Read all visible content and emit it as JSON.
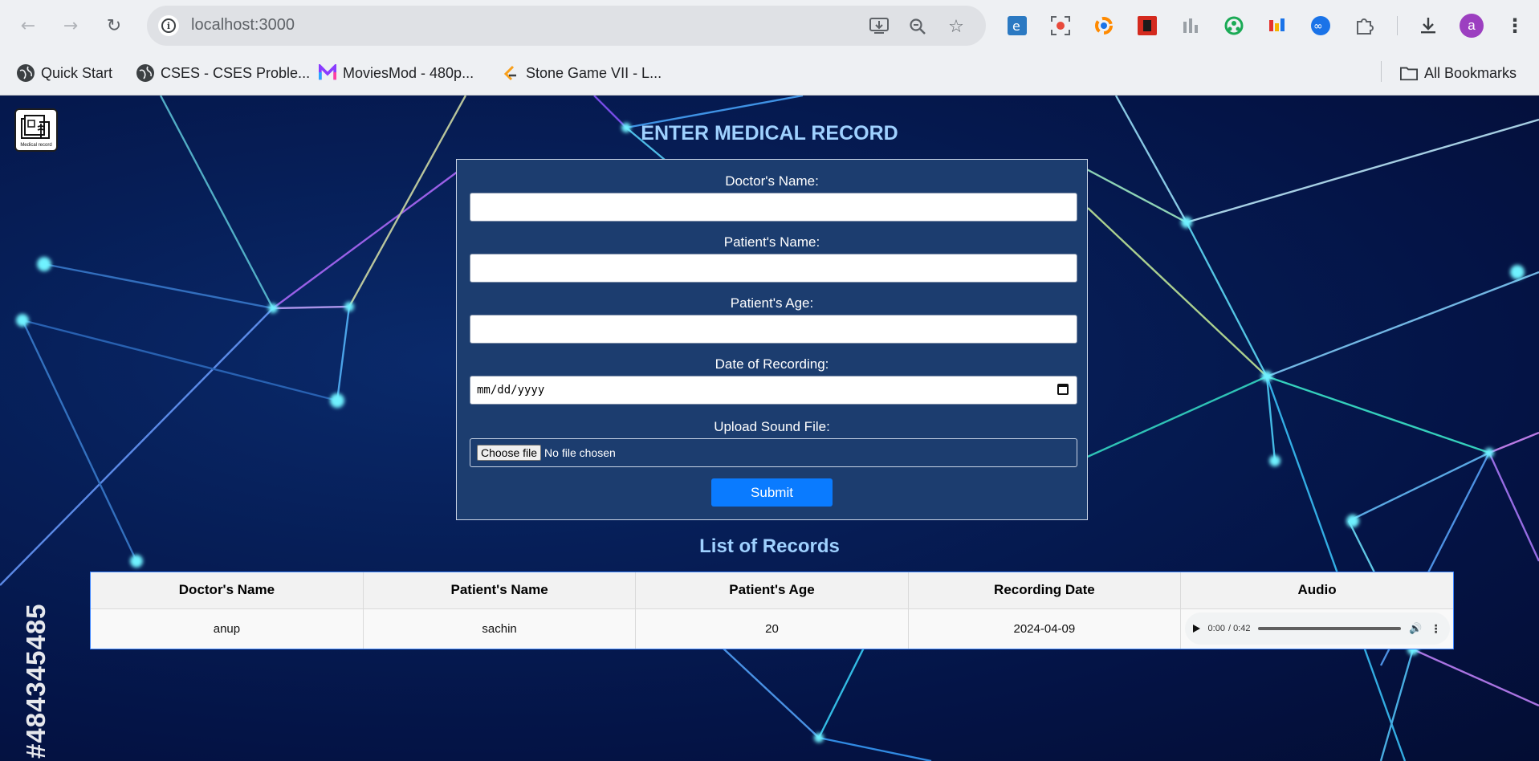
{
  "browser": {
    "url": "localhost:3000",
    "bookmarks": [
      {
        "label": "Quick Start"
      },
      {
        "label": "CSES - CSES Proble..."
      },
      {
        "label": "MoviesMod - 480p..."
      },
      {
        "label": "Stone Game VII - L..."
      }
    ],
    "all_bookmarks_label": "All Bookmarks",
    "avatar_letter": "a"
  },
  "logo": {
    "caption": "Medical record"
  },
  "watermark_id": "#484345485",
  "form": {
    "title": "ENTER MEDICAL RECORD",
    "doctor_label": "Doctor's Name:",
    "patient_label": "Patient's Name:",
    "age_label": "Patient's Age:",
    "date_label": "Date of Recording:",
    "date_placeholder": "mm/dd/yyyy",
    "file_label": "Upload Sound File:",
    "file_button": "Choose file",
    "file_status": "No file chosen",
    "submit_label": "Submit"
  },
  "records": {
    "title": "List of Records",
    "columns": [
      "Doctor's Name",
      "Patient's Name",
      "Patient's Age",
      "Recording Date",
      "Audio"
    ],
    "rows": [
      {
        "doctor": "anup",
        "patient": "sachin",
        "age": "20",
        "date": "2024-04-09",
        "audio_time": "0:00",
        "audio_duration": "/ 0:42"
      }
    ]
  },
  "colors": {
    "heading": "#9fd1ff",
    "card": "#1c3d6f",
    "submit": "#0a7bff"
  }
}
